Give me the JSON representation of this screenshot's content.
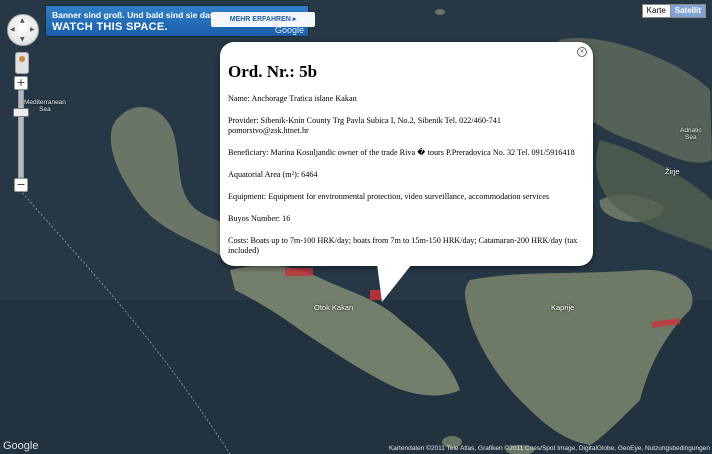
{
  "banner": {
    "line1": "Banner sind groß. Und bald sind sie das Größte.",
    "line2": "WATCH THIS SPACE.",
    "button": "MEHR ERFAHREN ▸",
    "google": "Google"
  },
  "map_type": {
    "karte": "Karte",
    "satellit": "Satellit"
  },
  "labels": {
    "mediterranean": "Mediterranean\nSea",
    "adriatic": "Adriatic\nSea",
    "otok_kakan": "Otok Kakan",
    "kaprije": "Kaprije",
    "zirje": "Žirje"
  },
  "info": {
    "title": "Ord. Nr.: 5b",
    "name": "Name: Anchorage Tratica islane Kakan",
    "provider": "Provider: Sibenik-Knin County Trg Pavla Subica I, No.2, Sibenik Tel. 022/460-741 pomorstvo@zsk.htnet.hr",
    "beneficiary": "Beneficiary: Marina Kosuljandic owner of the trade Riva � tours P.Preradovica No. 32 Tel. 091/5916418",
    "area": "Aquatorial Area (m²): 6464",
    "equipment": "Equipment: Equipment for environmental protection, video surveillance, accommodation services",
    "buyos": "Buyos Number: 16",
    "costs": "Costs: Boats up to 7m-100 HRK/day; boats from 7m to 15m-150 HRK/day; Catamaran-200 HRK/day (tax included)"
  },
  "footer": {
    "google": "Google",
    "copyright": "Kartendaten ©2011 Tele Atlas, Grafiken ©2011 Cnes/Spot Image, DigitalGlobe, GeoEye, Nutzungsbedingungen"
  },
  "colors": {
    "marker": "#c8323a",
    "water": "#223240",
    "land": "#6f7a68"
  }
}
